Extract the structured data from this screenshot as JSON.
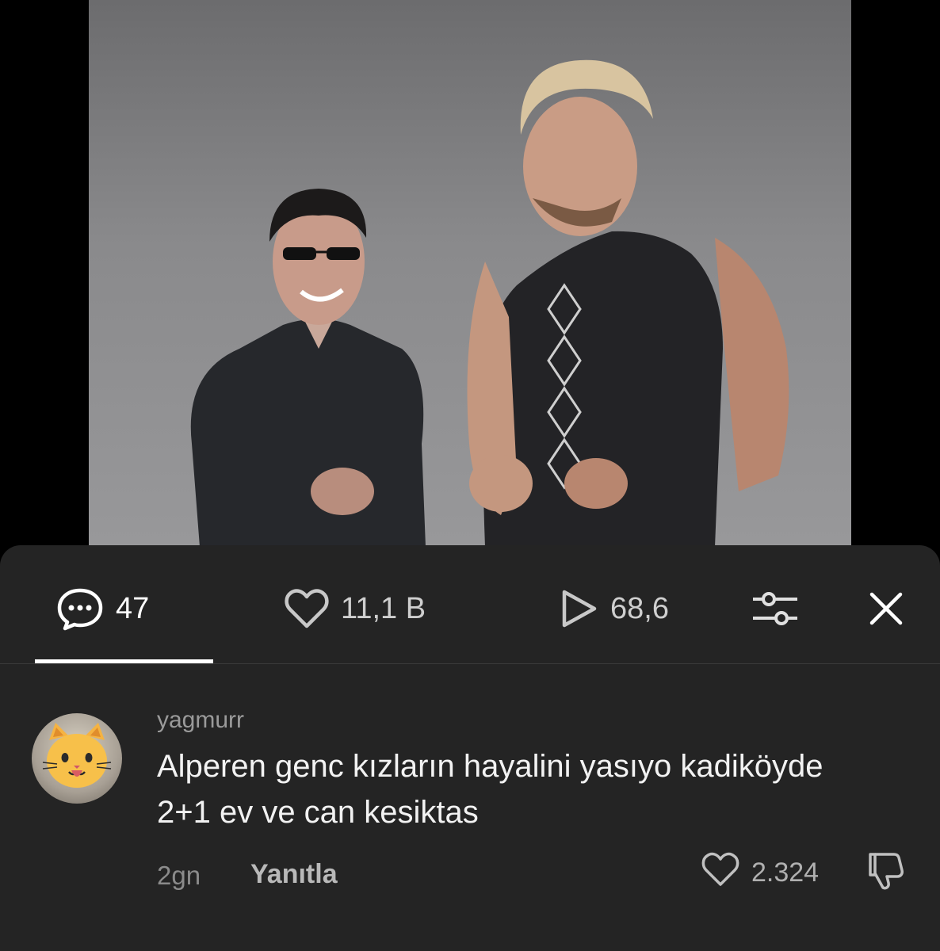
{
  "video": {
    "description": ""
  },
  "toolbar": {
    "comments_count": "47",
    "likes_count": "11,1 B",
    "views_count": "68,6",
    "icons": {
      "comments": "comment-bubble-icon",
      "likes": "heart-icon",
      "views": "play-icon",
      "filter": "sliders-icon",
      "close": "close-icon"
    }
  },
  "comment": {
    "username": "yagmurr",
    "text": "Alperen genc kızların hayalini yasıyo kadiköyde 2+1 ev ve can kesiktas",
    "time": "2gn",
    "reply_label": "Yanıtla",
    "like_count": "2.324",
    "avatar_icon": "cat-face-emoji-icon"
  },
  "colors": {
    "sheet_bg": "#242424",
    "page_bg": "#000000",
    "text_primary": "#f2f2f2",
    "text_secondary": "#9a9a9a",
    "accent_underline": "#ffffff"
  }
}
